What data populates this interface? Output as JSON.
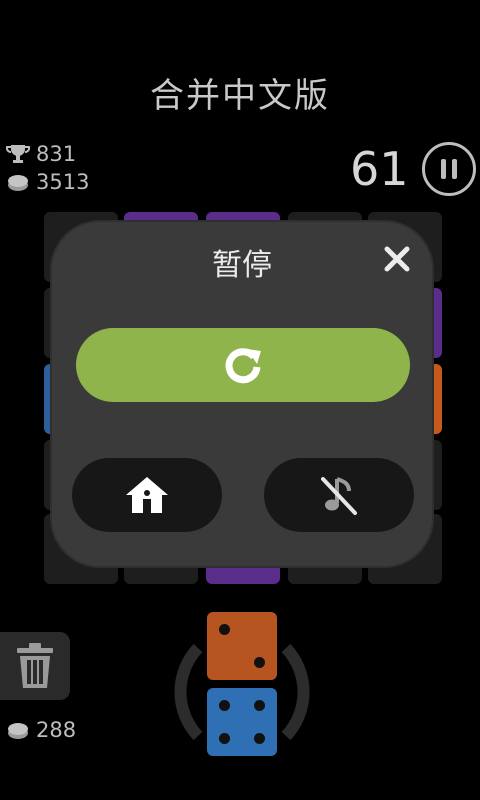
{
  "header": {
    "title": "合并中文版"
  },
  "stats": {
    "best": "831",
    "coins": "3513",
    "trash_cost": "288"
  },
  "score": {
    "value": "61"
  },
  "pause_dialog": {
    "title": "暂停",
    "close_icon": "close-icon",
    "restart_icon": "restart-icon",
    "home_icon": "home-icon",
    "sound_icon": "music-muted-icon"
  },
  "colors": {
    "accent_green": "#8fb44b",
    "purple_tile": "#5b2d8a",
    "blue_tile": "#2f5f9a",
    "orange_tile": "#c55a1c",
    "die_orange": "#b65520",
    "die_blue": "#2f6fb3"
  },
  "dice": [
    {
      "color": "orange",
      "value": 2
    },
    {
      "color": "blue",
      "value": 4
    }
  ]
}
